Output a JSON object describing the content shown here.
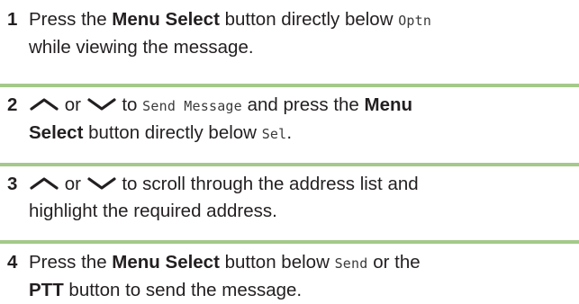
{
  "steps": [
    {
      "number": "1",
      "t1": "Press the ",
      "b1": "Menu Select",
      "t2": " button directly below ",
      "m1": "Optn",
      "t3": "while viewing the message."
    },
    {
      "number": "2",
      "or": " or ",
      "t1": " to ",
      "m1": "Send Message",
      "t2": " and press the ",
      "b1": "Menu",
      "b2": "Select",
      "t3": " button directly below ",
      "m2": "Sel",
      "t4": "."
    },
    {
      "number": "3",
      "or": " or ",
      "t1": " to scroll through the address list and",
      "t2": "highlight the required address."
    },
    {
      "number": "4",
      "t1": "Press the ",
      "b1": "Menu Select",
      "t2": " button below ",
      "m1": "Send",
      "t3": " or the",
      "b2": "PTT",
      "t4": " button to send the message."
    }
  ],
  "icons": {
    "up": "chevron-up-icon",
    "down": "chevron-down-icon"
  },
  "colors": {
    "divider": "#a4c98a",
    "text": "#231f20"
  }
}
